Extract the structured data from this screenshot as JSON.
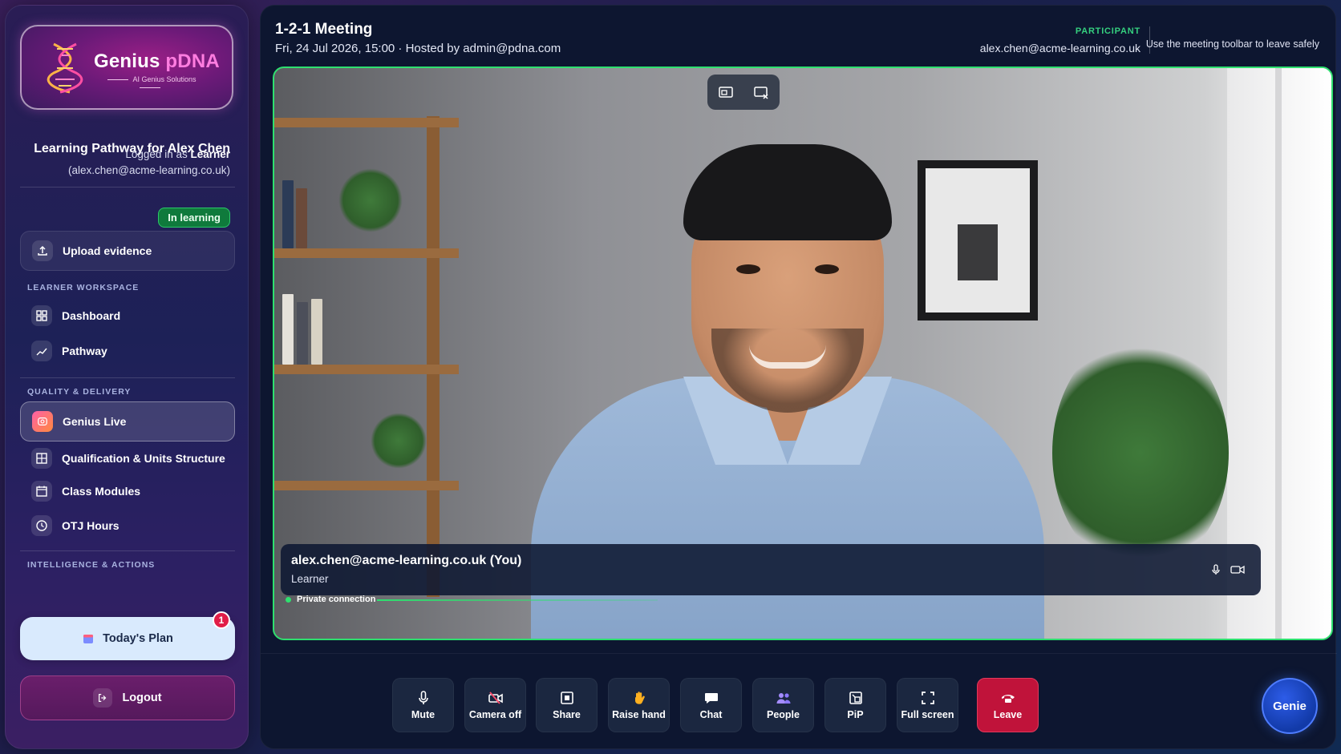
{
  "brand": {
    "name_part1": "Genius ",
    "name_part2": "pDNA",
    "tagline": "AI Genius Solutions"
  },
  "profile": {
    "title": "Learning Pathway for Alex Chen",
    "logged_prefix": "Logged in as ",
    "role": "Learner",
    "email": "(alex.chen@acme-learning.co.uk)",
    "status": "In learning"
  },
  "sidebar": {
    "upload_label": "Upload evidence",
    "sections": {
      "learner": "LEARNER WORKSPACE",
      "quality": "QUALITY & DELIVERY",
      "intelligence": "INTELLIGENCE & ACTIONS"
    },
    "items": {
      "dashboard": "Dashboard",
      "pathway": "Pathway",
      "genius_live": "Genius Live",
      "qualification": "Qualification & Units Structure",
      "class_modules": "Class Modules",
      "otj_hours": "OTJ Hours"
    },
    "todays_plan": "Today's Plan",
    "todays_plan_count": "1",
    "logout": "Logout"
  },
  "meeting": {
    "title": "1-2-1 Meeting",
    "subtitle": "Fri, 24 Jul 2026, 15:00 · Hosted by admin@pdna.com",
    "role_label": "PARTICIPANT",
    "participant_email": "alex.chen@acme-learning.co.uk",
    "hint": "Use the meeting toolbar to leave safely"
  },
  "video": {
    "name": "alex.chen@acme-learning.co.uk (You)",
    "role": "Learner",
    "connection": "Private connection"
  },
  "toolbar": {
    "mute": "Mute",
    "camera": "Camera off",
    "share": "Share",
    "raise_hand": "Raise hand",
    "chat": "Chat",
    "people": "People",
    "pip": "PiP",
    "fullscreen": "Full screen",
    "leave": "Leave",
    "genie": "Genie"
  },
  "colors": {
    "accent_green": "#2ee06f",
    "leave_red": "#c0133a",
    "brand_pink": "#ff7de0"
  }
}
